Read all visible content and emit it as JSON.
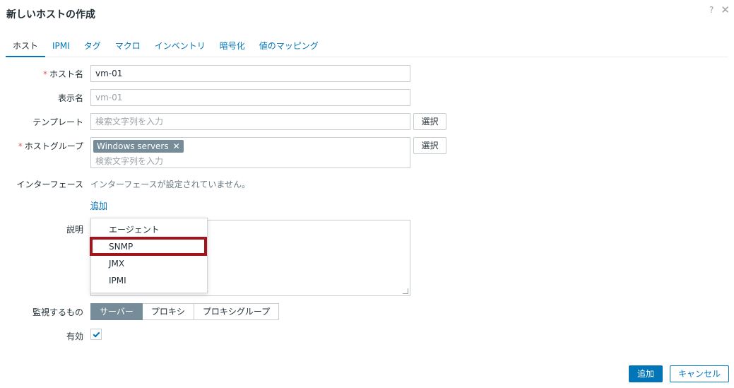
{
  "dialog": {
    "title": "新しいホストの作成",
    "help_icon": "?",
    "close_icon": "✕"
  },
  "tabs": [
    {
      "label": "ホスト",
      "active": true
    },
    {
      "label": "IPMI"
    },
    {
      "label": "タグ"
    },
    {
      "label": "マクロ"
    },
    {
      "label": "インベントリ"
    },
    {
      "label": "暗号化"
    },
    {
      "label": "値のマッピング"
    }
  ],
  "form": {
    "host_name": {
      "label": "ホスト名",
      "required_mark": "*",
      "value": "vm-01"
    },
    "visible_name": {
      "label": "表示名",
      "placeholder": "vm-01"
    },
    "templates": {
      "label": "テンプレート",
      "placeholder": "検索文字列を入力",
      "select_label": "選択"
    },
    "host_groups": {
      "label": "ホストグループ",
      "required_mark": "*",
      "chip": "Windows servers",
      "chip_remove": "✕",
      "placeholder": "検索文字列を入力",
      "select_label": "選択"
    },
    "interfaces": {
      "label": "インターフェース",
      "empty_text": "インターフェースが設定されていません。",
      "add_link": "追加"
    },
    "description": {
      "label": "説明"
    },
    "monitored_by": {
      "label": "監視するもの",
      "options": [
        {
          "label": "サーバー",
          "selected": true
        },
        {
          "label": "プロキシ"
        },
        {
          "label": "プロキシグループ"
        }
      ]
    },
    "enabled": {
      "label": "有効",
      "checked": true
    }
  },
  "interface_menu": {
    "items": [
      "エージェント",
      "SNMP",
      "JMX",
      "IPMI"
    ],
    "highlighted": "SNMP"
  },
  "footer": {
    "add_label": "追加",
    "cancel_label": "キャンセル"
  }
}
